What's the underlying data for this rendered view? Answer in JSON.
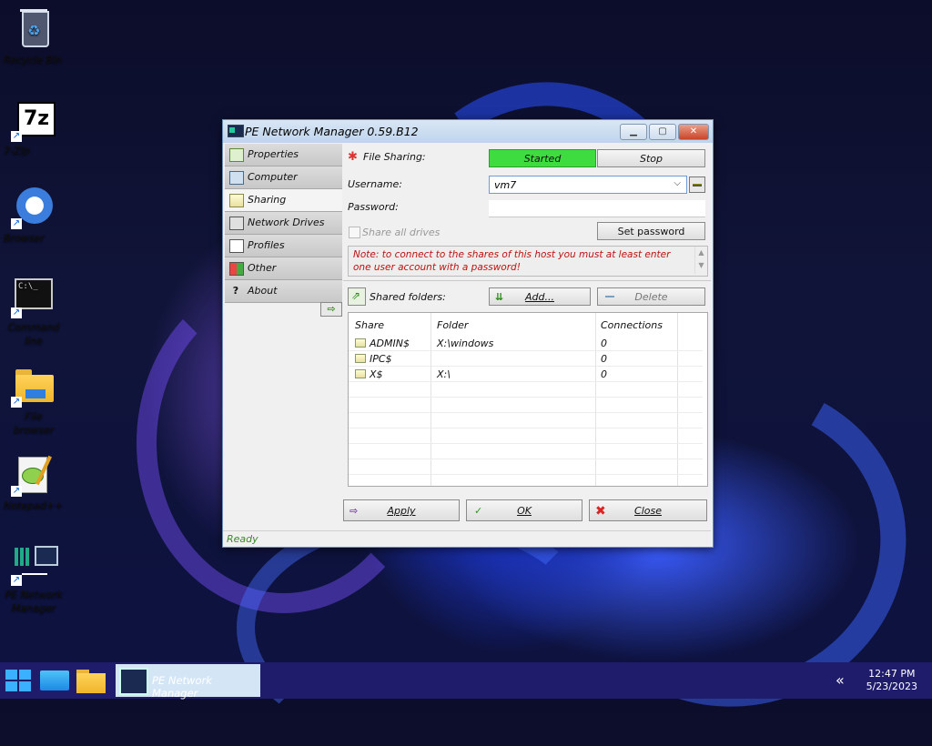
{
  "desktop": {
    "icons": [
      {
        "label": "Recycle Bin"
      },
      {
        "label": "7-Zip"
      },
      {
        "label": "Browser"
      },
      {
        "label": "Command line"
      },
      {
        "label": "File browser"
      },
      {
        "label": "Notepad++"
      },
      {
        "label": "PE Network Manager"
      }
    ]
  },
  "window": {
    "title": "PE Network Manager 0.59.B12",
    "nav": [
      {
        "label": "Properties"
      },
      {
        "label": "Computer"
      },
      {
        "label": "Sharing"
      },
      {
        "label": "Network Drives"
      },
      {
        "label": "Profiles"
      },
      {
        "label": "Other"
      },
      {
        "label": "About"
      }
    ],
    "sharing": {
      "file_sharing_label": "File Sharing:",
      "started_label": "Started",
      "stop_label": "Stop",
      "username_label": "Username:",
      "username_value": "vm7",
      "password_label": "Password:",
      "share_all_label": "Share all drives",
      "set_password_label": "Set password",
      "note": "Note: to connect to the shares of this host you must at least enter one user account with a password!",
      "shared_folders_label": "Shared folders:",
      "add_label": "Add...",
      "delete_label": "Delete",
      "table": {
        "headers": [
          "Share",
          "Folder",
          "Connections"
        ],
        "rows": [
          {
            "share": "ADMIN$",
            "folder": "X:\\windows",
            "connections": "0"
          },
          {
            "share": "IPC$",
            "folder": "",
            "connections": "0"
          },
          {
            "share": "X$",
            "folder": "X:\\",
            "connections": "0"
          }
        ]
      }
    },
    "buttons": {
      "apply": "Apply",
      "ok": "OK",
      "close": "Close"
    },
    "status": "Ready"
  },
  "taskbar": {
    "app_label": "PE Network Manager",
    "time": "12:47 PM",
    "date": "5/23/2023"
  }
}
